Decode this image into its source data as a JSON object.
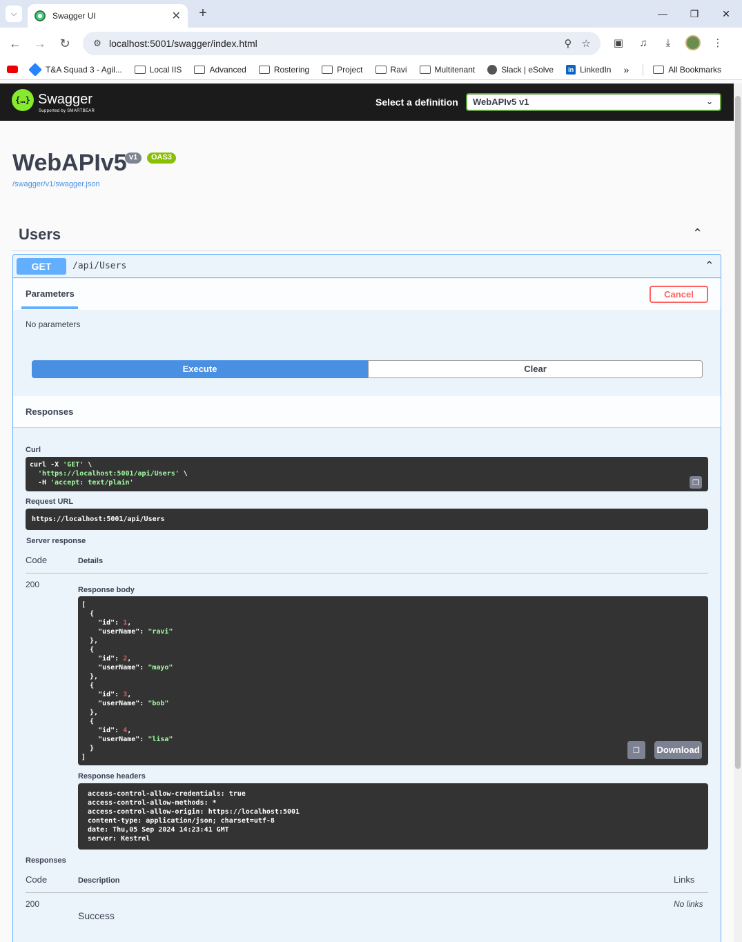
{
  "browser": {
    "tab_title": "Swagger UI",
    "url": "localhost:5001/swagger/index.html",
    "bookmarks": [
      {
        "label": "",
        "icon": "youtube-icon"
      },
      {
        "label": "T&A Squad 3 - Agil...",
        "icon": "jira-icon"
      },
      {
        "label": "Local IIS",
        "icon": "folder-icon"
      },
      {
        "label": "Advanced",
        "icon": "folder-icon"
      },
      {
        "label": "Rostering",
        "icon": "folder-icon"
      },
      {
        "label": "Project",
        "icon": "folder-icon"
      },
      {
        "label": "Ravi",
        "icon": "folder-icon"
      },
      {
        "label": "Multitenant",
        "icon": "folder-icon"
      },
      {
        "label": "Slack | eSolve",
        "icon": "globe-icon"
      },
      {
        "label": "LinkedIn",
        "icon": "linkedin-icon"
      }
    ],
    "all_bookmarks": "All Bookmarks"
  },
  "swagger": {
    "brand": "Swagger",
    "brand_sub": "Supported by SMARTBEAR",
    "definition_label": "Select a definition",
    "definition_value": "WebAPIv5 v1",
    "title": "WebAPIv5",
    "version_badge": "v1",
    "oas_badge": "OAS3",
    "spec_link": "/swagger/v1/swagger.json",
    "tag": "Users",
    "operation": {
      "method": "GET",
      "path": "/api/Users",
      "params_tab": "Parameters",
      "cancel": "Cancel",
      "no_params": "No parameters",
      "execute": "Execute",
      "clear": "Clear",
      "responses_head": "Responses",
      "curl_label": "Curl",
      "curl": {
        "line1_cmd": "curl -X ",
        "line1_str": "'GET'",
        "line1_tail": " \\",
        "line2_str": "  'https://localhost:5001/api/Users'",
        "line2_tail": " \\",
        "line3_cmd": "  -H ",
        "line3_str": "'accept: text/plain'"
      },
      "request_url_label": "Request URL",
      "request_url": "https://localhost:5001/api/Users",
      "server_response_label": "Server response",
      "code_header": "Code",
      "details_header": "Details",
      "status_code": "200",
      "response_body_label": "Response body",
      "users": [
        {
          "id": "1",
          "userName": "\"ravi\""
        },
        {
          "id": "2",
          "userName": "\"mayo\""
        },
        {
          "id": "3",
          "userName": "\"bob\""
        },
        {
          "id": "4",
          "userName": "\"lisa\""
        }
      ],
      "download": "Download",
      "response_headers_label": "Response headers",
      "response_headers": [
        "access-control-allow-credentials: true",
        "access-control-allow-methods: *",
        "access-control-allow-origin: https://localhost:5001",
        "content-type: application/json; charset=utf-8",
        "date: Thu,05 Sep 2024 14:23:41 GMT",
        "server: Kestrel"
      ],
      "responses_label": "Responses",
      "desc_header": "Description",
      "links_header": "Links",
      "resp_code": "200",
      "resp_desc": "Success",
      "no_links": "No links"
    }
  }
}
